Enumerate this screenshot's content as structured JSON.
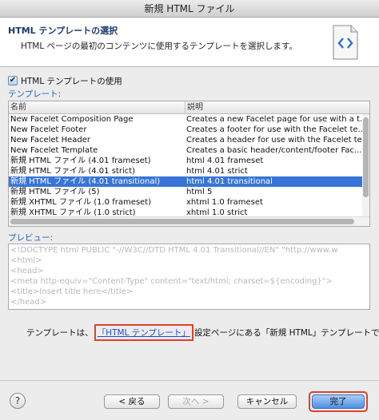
{
  "window": {
    "title": "新規 HTML ファイル"
  },
  "header": {
    "title": "HTML テンプレートの選択",
    "description": "HTML ページの最初のコンテンツに使用するテンプレートを選択します。",
    "icon": "html-file-icon"
  },
  "use_template": {
    "label": "HTML テンプレートの使用",
    "checked": true
  },
  "templates": {
    "section_label": "テンプレート:",
    "columns": [
      "名前",
      "説明"
    ],
    "selected_index": 6,
    "rows": [
      {
        "name": "New Facelet Composition Page",
        "desc": "Creates a new Facelet page for use with a t..."
      },
      {
        "name": "New Facelet Footer",
        "desc": "Creates a footer for use with the Facelet te..."
      },
      {
        "name": "New Facelet Header",
        "desc": "Creates a header for use with the Facelet te..."
      },
      {
        "name": "New Facelet Template",
        "desc": "Creates a basic header/content/footer Fac..."
      },
      {
        "name": "新規 HTML ファイル (4.01 frameset)",
        "desc": "html 4.01 frameset"
      },
      {
        "name": "新規 HTML ファイル (4.01 strict)",
        "desc": "html 4.01 strict"
      },
      {
        "name": "新規 HTML ファイル (4.01 transitional)",
        "desc": "html 4.01 transitional"
      },
      {
        "name": "新規 HTML ファイル (5)",
        "desc": "html 5"
      },
      {
        "name": "新規 XHTML ファイル (1.0 frameset)",
        "desc": "xhtml 1.0 frameset"
      },
      {
        "name": "新規 XHTML ファイル (1.0 strict)",
        "desc": "xhtml 1.0 strict"
      }
    ]
  },
  "preview": {
    "section_label": "プレビュー:",
    "lines": [
      "<!DOCTYPE html PUBLIC \"-//W3C//DTD HTML 4.01 Transitional//EN\" \"http://www.w",
      "<html>",
      "<head>",
      "<meta http-equiv=\"Content-Type\" content=\"text/html; charset=${encoding}\">",
      "<title>Insert title here</title>",
      "</head>"
    ]
  },
  "info": {
    "prefix": "テンプレートは、",
    "link": "「HTML テンプレート」",
    "suffix": "設定ページにある「新規 HTML」テンプレートです。"
  },
  "buttons": {
    "help": "?",
    "back": "< 戻る",
    "next": "次へ >",
    "cancel": "キャンセル",
    "finish": "完了"
  },
  "colors": {
    "selection": "#3875d7",
    "section_label": "#2860b8",
    "link": "#1f50c8",
    "highlight_box": "#e0402a",
    "primary_button": "#4f8fe0"
  }
}
